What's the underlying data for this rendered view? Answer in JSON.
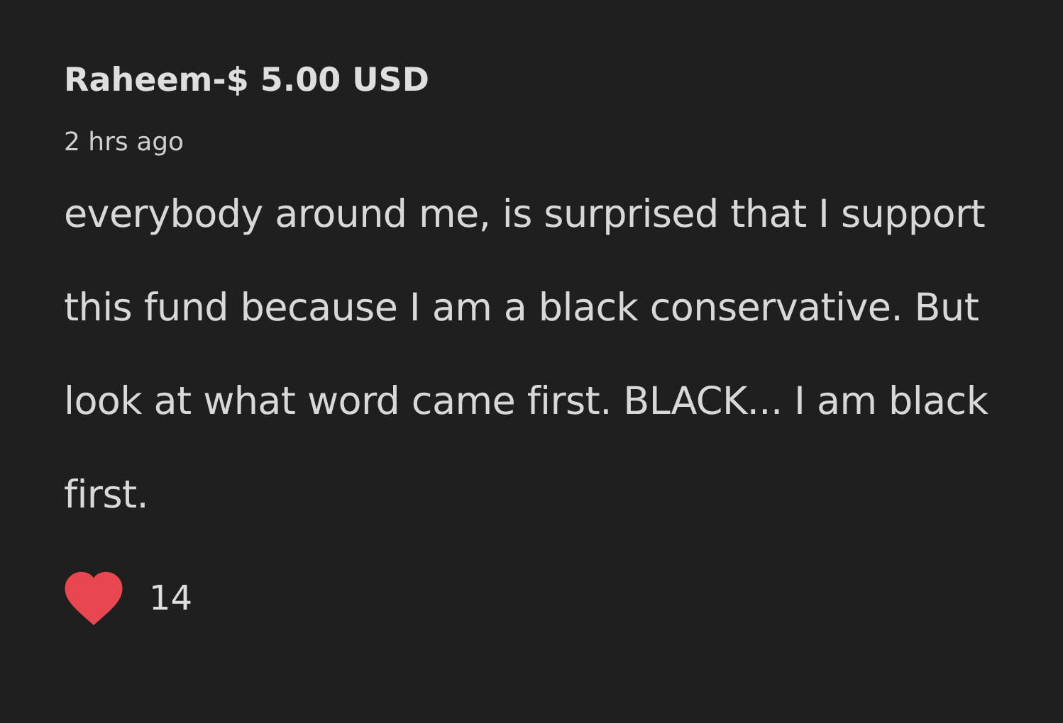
{
  "comment": {
    "author": "Raheem-$ 5.00 USD",
    "time": "2 hrs ago",
    "body": "everybody around me, is surprised that I support this fund because I am a black conservative. But look at what word came first. BLACK... I am black first.",
    "liked": true,
    "likes": "14"
  }
}
